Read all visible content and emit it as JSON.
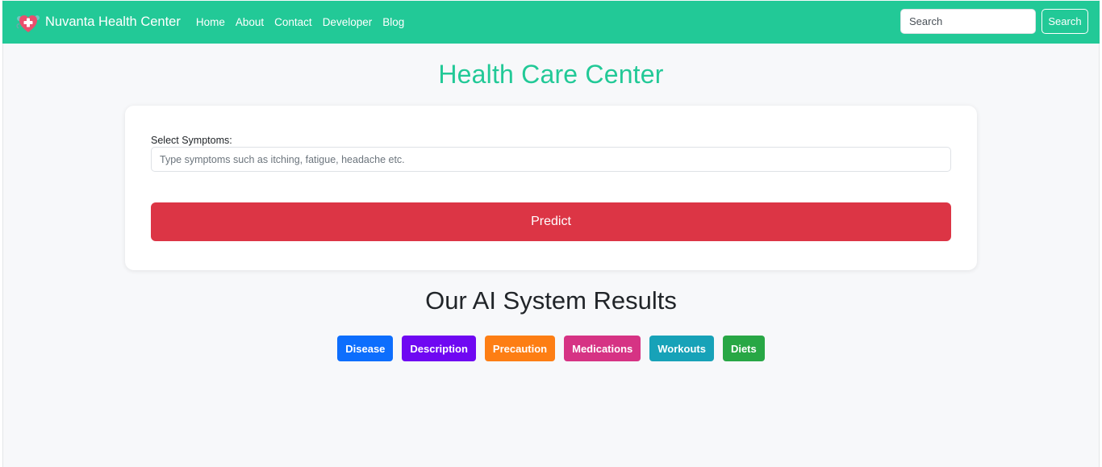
{
  "navbar": {
    "brand": "Nuvanta Health Center",
    "links": [
      "Home",
      "About",
      "Contact",
      "Developer",
      "Blog"
    ],
    "search_placeholder": "Search",
    "search_button": "Search",
    "color": "#22c997"
  },
  "main": {
    "title": "Health Care Center",
    "symptoms_label": "Select Symptoms:",
    "symptoms_placeholder": "Type symptoms such as itching, fatigue, headache etc.",
    "predict_button": "Predict",
    "results_title": "Our AI System Results",
    "result_buttons": [
      {
        "label": "Disease",
        "color": "#0d6efd"
      },
      {
        "label": "Description",
        "color": "#6f08f2"
      },
      {
        "label": "Precaution",
        "color": "#fd7e14"
      },
      {
        "label": "Medications",
        "color": "#d63384"
      },
      {
        "label": "Workouts",
        "color": "#17a2b8"
      },
      {
        "label": "Diets",
        "color": "#28a745"
      }
    ]
  },
  "icons": {
    "logo": "medical-cross-heart-icon"
  }
}
